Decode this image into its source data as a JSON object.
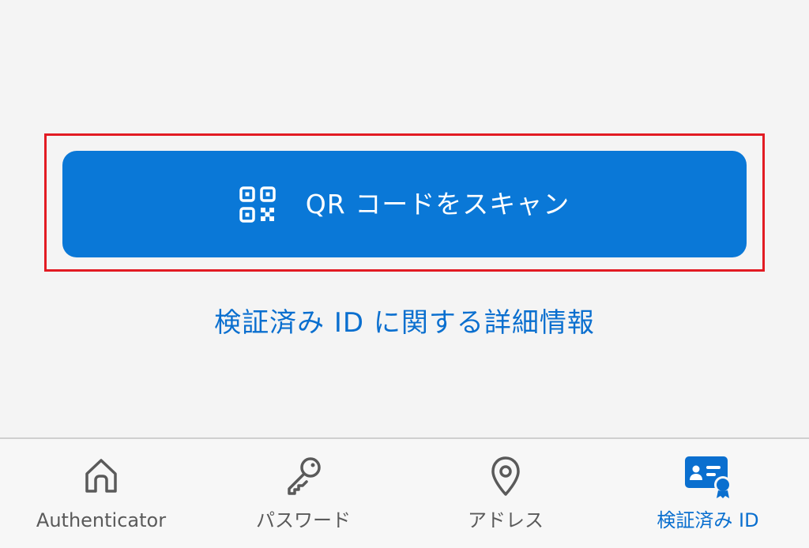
{
  "main": {
    "scan_button_label": "QR コードをスキャン",
    "learn_more_link": "検証済み ID に関する詳細情報"
  },
  "tabbar": {
    "items": [
      {
        "label": "Authenticator",
        "icon": "home-icon",
        "active": false
      },
      {
        "label": "パスワード",
        "icon": "key-icon",
        "active": false
      },
      {
        "label": "アドレス",
        "icon": "location-pin-icon",
        "active": false
      },
      {
        "label": "検証済み ID",
        "icon": "verified-id-icon",
        "active": true
      }
    ]
  },
  "colors": {
    "accent": "#0a78d7",
    "link": "#0a6fcf",
    "highlight": "#e21b23",
    "background": "#f4f4f4",
    "inactive_tab": "#5a5a5a"
  }
}
